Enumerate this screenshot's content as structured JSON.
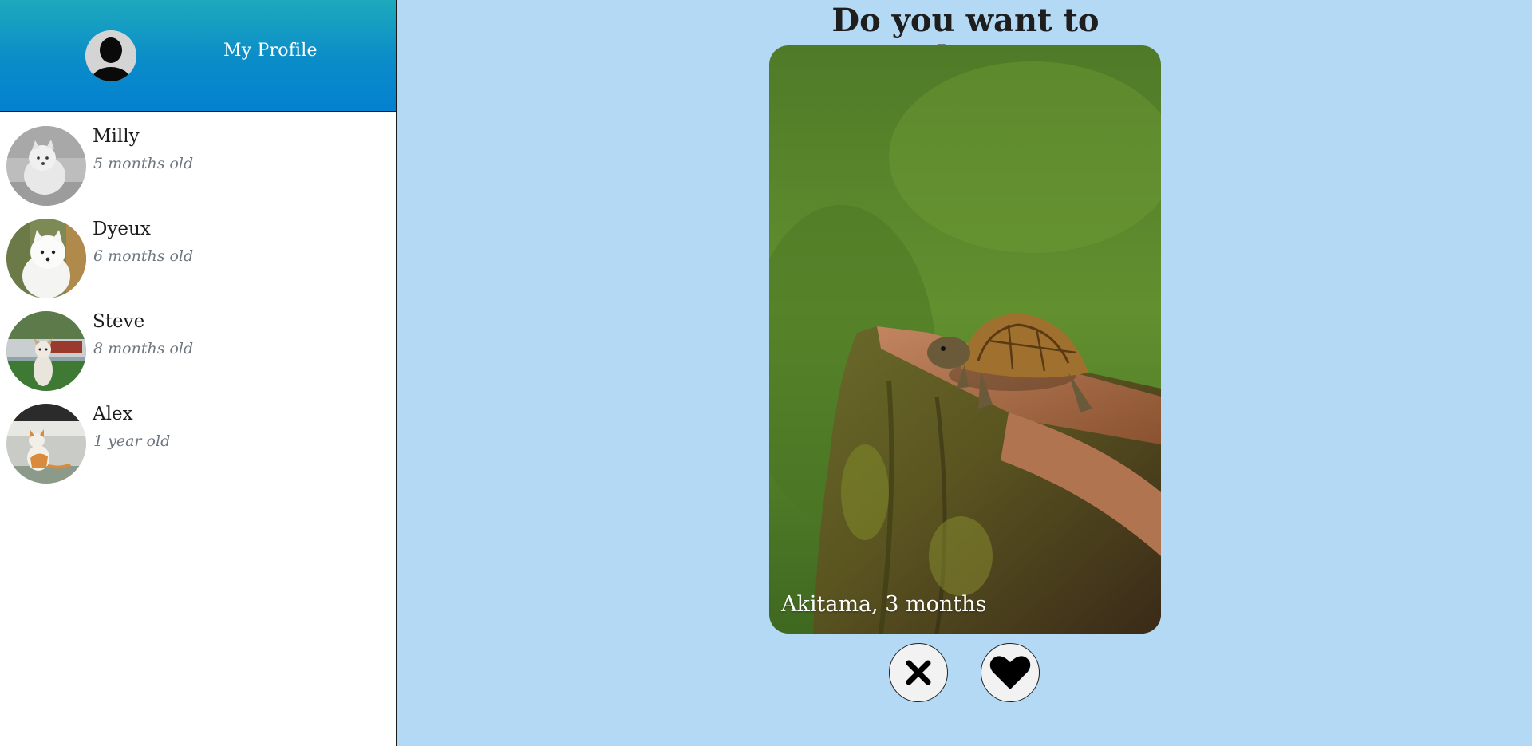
{
  "profile": {
    "title": "My Profile",
    "avatar_icon": "person-icon"
  },
  "pets": [
    {
      "name": "Milly",
      "age": "5 months old"
    },
    {
      "name": "Dyeux",
      "age": "6 months old"
    },
    {
      "name": "Steve",
      "age": "8 months old"
    },
    {
      "name": "Alex",
      "age": "1 year old"
    }
  ],
  "main": {
    "question": "Do you want to adopt?",
    "card_caption": "Akitama, 3 months"
  },
  "actions": {
    "reject_icon": "close-icon",
    "like_icon": "heart-icon"
  },
  "colors": {
    "page_background": "#b4d9f5",
    "header_gradient_top": "#1ea9bd",
    "header_gradient_bottom": "#0481d0"
  }
}
